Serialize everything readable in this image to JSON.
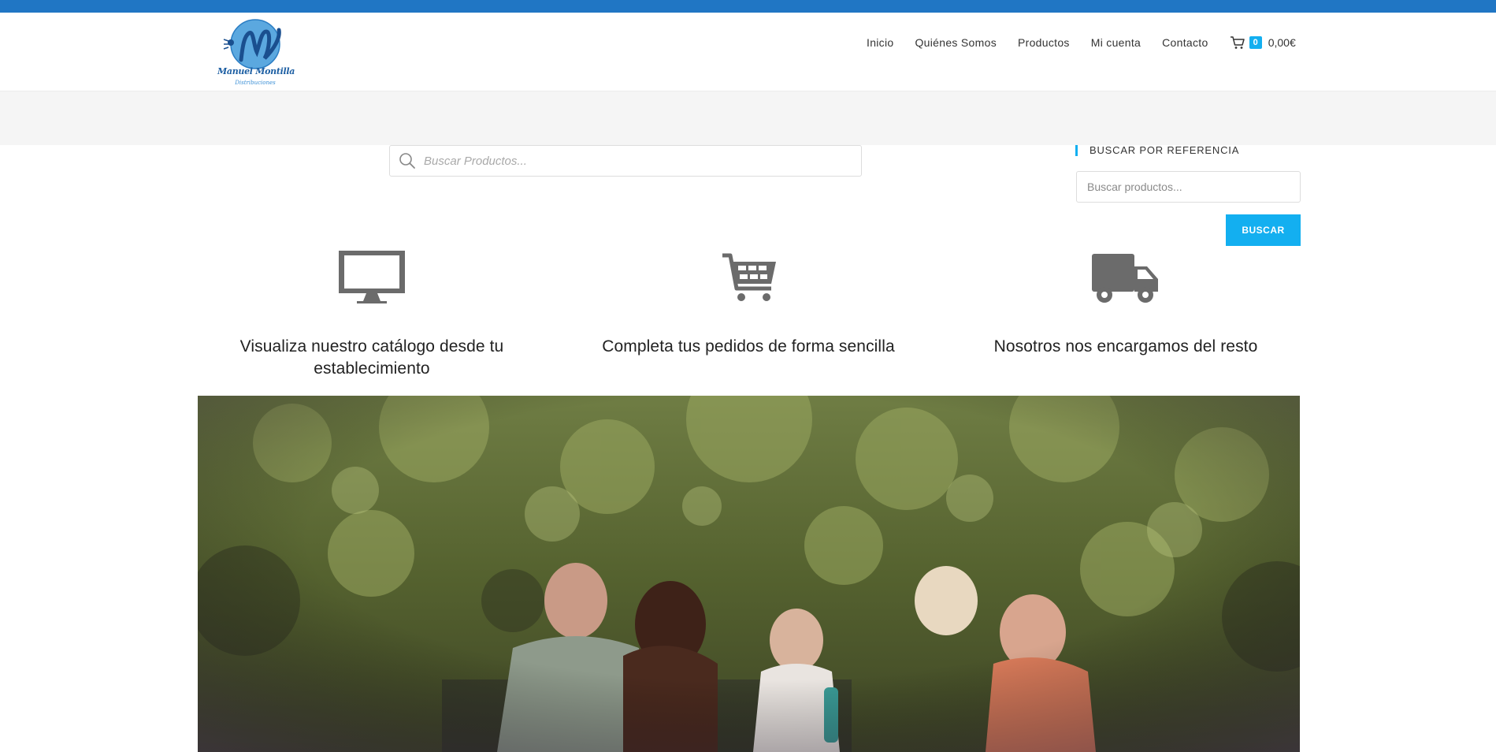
{
  "header": {
    "logo_name": "Manuel Montilla",
    "logo_sub": "Distribuciones"
  },
  "nav": {
    "items": [
      "Inicio",
      "Quiénes Somos",
      "Productos",
      "Mi cuenta",
      "Contacto"
    ],
    "cart_count": "0",
    "cart_total": "0,00€"
  },
  "search": {
    "placeholder": "Buscar Productos..."
  },
  "sidebar": {
    "title": "BUSCAR POR REFERENCIA",
    "input_placeholder": "Buscar productos...",
    "button_label": "BUSCAR"
  },
  "features": [
    {
      "icon": "monitor-icon",
      "title": "Visualiza nuestro catálogo desde tu establecimiento"
    },
    {
      "icon": "shopping-cart-icon",
      "title": "Completa tus pedidos de forma sencilla"
    },
    {
      "icon": "delivery-truck-icon",
      "title": "Nosotros nos encargamos del resto"
    }
  ],
  "colors": {
    "top_bar": "#2076c4",
    "accent": "#13aff0",
    "icon_gray": "#6b6b6b"
  }
}
